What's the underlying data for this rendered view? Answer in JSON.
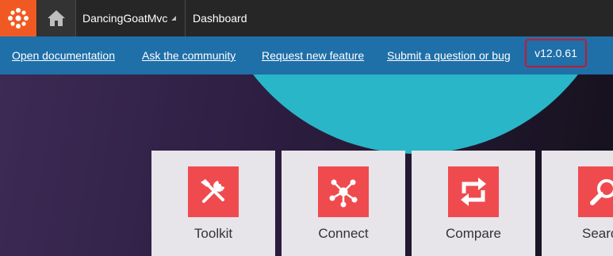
{
  "header": {
    "site_name": "DancingGoatMvc",
    "app_name": "Dashboard"
  },
  "links": [
    {
      "label": "Open documentation"
    },
    {
      "label": "Ask the community"
    },
    {
      "label": "Request new feature"
    },
    {
      "label": "Submit a question or bug"
    }
  ],
  "version": "v12.0.61",
  "tiles": [
    {
      "label": "Toolkit",
      "icon": "toolkit-icon"
    },
    {
      "label": "Connect",
      "icon": "connect-icon"
    },
    {
      "label": "Compare",
      "icon": "compare-icon"
    },
    {
      "label": "Searc",
      "icon": "search-icon"
    }
  ],
  "colors": {
    "brand_orange": "#f05a22",
    "link_bar": "#1f6fa8",
    "version_border": "#c7192e",
    "tile_icon": "#ef4b4f",
    "hero_circle": "#29b6c8"
  }
}
